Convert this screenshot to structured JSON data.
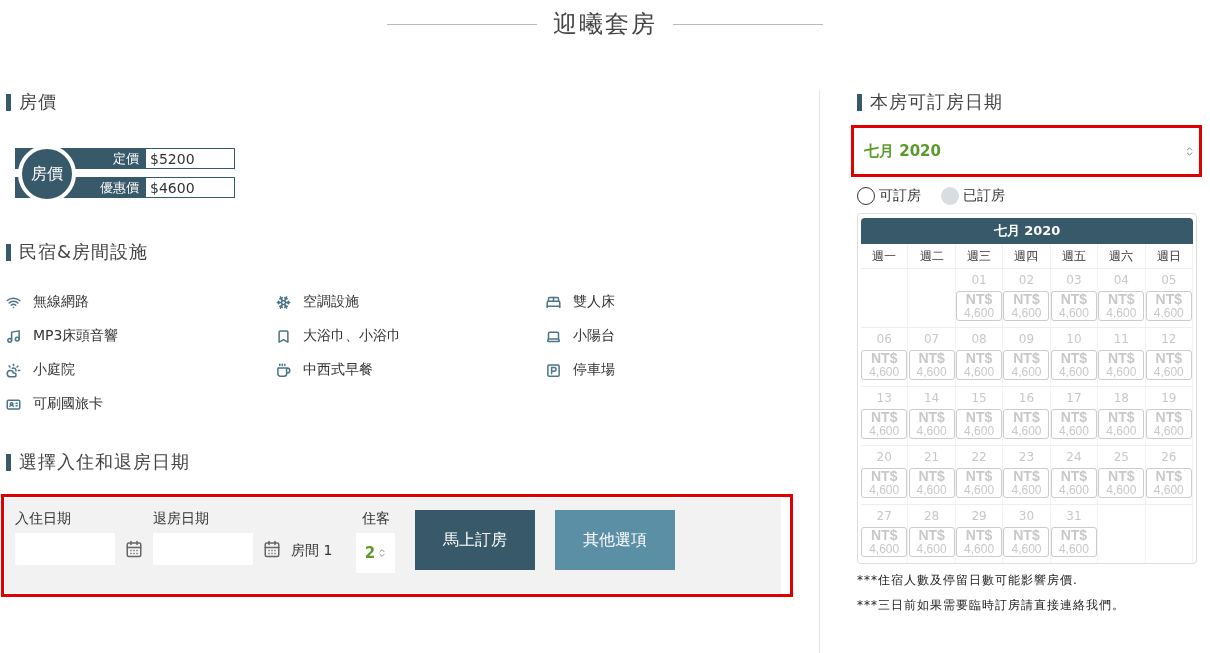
{
  "title": "迎曦套房",
  "price": {
    "heading": "房價",
    "badge": "房價",
    "rows": [
      {
        "label": "定價",
        "value": "$5200"
      },
      {
        "label": "優惠價",
        "value": "$4600"
      }
    ]
  },
  "facilities": {
    "heading": "民宿&房間設施",
    "items": [
      {
        "label": "無線網路"
      },
      {
        "label": "空調設施"
      },
      {
        "label": "雙人床"
      },
      {
        "label": "MP3床頭音響"
      },
      {
        "label": "大浴巾、小浴巾"
      },
      {
        "label": "小陽台"
      },
      {
        "label": "小庭院"
      },
      {
        "label": "中西式早餐"
      },
      {
        "label": "停車場"
      },
      {
        "label": "可刷國旅卡"
      }
    ]
  },
  "booking": {
    "heading": "選擇入住和退房日期",
    "highlighted": true,
    "checkin_label": "入住日期",
    "checkout_label": "退房日期",
    "room_label": "房間 1",
    "guests_label": "住客",
    "guests_value": "2",
    "buttons": [
      {
        "label": "馬上訂房",
        "kind": "primary"
      },
      {
        "label": "其他選項",
        "kind": "secondary"
      }
    ]
  },
  "availability": {
    "heading": "本房可訂房日期",
    "month_select": {
      "value": "七月 2020",
      "highlighted": true
    },
    "legend": [
      {
        "label": "可訂房",
        "kind": "available"
      },
      {
        "label": "已訂房",
        "kind": "booked"
      }
    ],
    "calendar": {
      "title": "七月 2020",
      "weekdays": [
        "週一",
        "週二",
        "週三",
        "週四",
        "週五",
        "週六",
        "週日"
      ],
      "days": [
        {
          "kind": "blank"
        },
        {
          "kind": "blank"
        },
        {
          "kind": "day",
          "day": "01",
          "currency": "NT$",
          "price": "4,600",
          "disabled": true
        },
        {
          "kind": "day",
          "day": "02",
          "currency": "NT$",
          "price": "4,600",
          "disabled": true
        },
        {
          "kind": "day",
          "day": "03",
          "currency": "NT$",
          "price": "4,600",
          "disabled": true
        },
        {
          "kind": "day",
          "day": "04",
          "currency": "NT$",
          "price": "4,600",
          "disabled": true
        },
        {
          "kind": "day",
          "day": "05",
          "currency": "NT$",
          "price": "4,600",
          "disabled": true
        },
        {
          "kind": "day",
          "day": "06",
          "currency": "NT$",
          "price": "4,600",
          "disabled": true
        },
        {
          "kind": "day",
          "day": "07",
          "currency": "NT$",
          "price": "4,600",
          "disabled": true
        },
        {
          "kind": "day",
          "day": "08",
          "currency": "NT$",
          "price": "4,600",
          "disabled": true
        },
        {
          "kind": "day",
          "day": "09",
          "currency": "NT$",
          "price": "4,600",
          "disabled": true
        },
        {
          "kind": "day",
          "day": "10",
          "currency": "NT$",
          "price": "4,600",
          "disabled": true
        },
        {
          "kind": "day",
          "day": "11",
          "currency": "NT$",
          "price": "4,600",
          "disabled": true
        },
        {
          "kind": "day",
          "day": "12",
          "currency": "NT$",
          "price": "4,600",
          "disabled": true
        },
        {
          "kind": "day",
          "day": "13",
          "currency": "NT$",
          "price": "4,600",
          "disabled": true
        },
        {
          "kind": "day",
          "day": "14",
          "currency": "NT$",
          "price": "4,600",
          "disabled": true
        },
        {
          "kind": "day",
          "day": "15",
          "currency": "NT$",
          "price": "4,600",
          "disabled": true
        },
        {
          "kind": "day",
          "day": "16",
          "currency": "NT$",
          "price": "4,600",
          "disabled": true
        },
        {
          "kind": "day",
          "day": "17",
          "currency": "NT$",
          "price": "4,600",
          "disabled": true
        },
        {
          "kind": "day",
          "day": "18",
          "currency": "NT$",
          "price": "4,600",
          "disabled": true
        },
        {
          "kind": "day",
          "day": "19",
          "currency": "NT$",
          "price": "4,600",
          "disabled": true
        },
        {
          "kind": "day",
          "day": "20",
          "currency": "NT$",
          "price": "4,600",
          "disabled": true
        },
        {
          "kind": "day",
          "day": "21",
          "currency": "NT$",
          "price": "4,600",
          "disabled": true
        },
        {
          "kind": "day",
          "day": "22",
          "currency": "NT$",
          "price": "4,600",
          "disabled": true
        },
        {
          "kind": "day",
          "day": "23",
          "currency": "NT$",
          "price": "4,600",
          "disabled": true
        },
        {
          "kind": "day",
          "day": "24",
          "currency": "NT$",
          "price": "4,600",
          "disabled": true
        },
        {
          "kind": "day",
          "day": "25",
          "currency": "NT$",
          "price": "4,600",
          "disabled": true
        },
        {
          "kind": "day",
          "day": "26",
          "currency": "NT$",
          "price": "4,600",
          "disabled": true
        },
        {
          "kind": "day",
          "day": "27",
          "currency": "NT$",
          "price": "4,600",
          "disabled": true
        },
        {
          "kind": "day",
          "day": "28",
          "currency": "NT$",
          "price": "4,600",
          "disabled": true
        },
        {
          "kind": "day",
          "day": "29",
          "currency": "NT$",
          "price": "4,600",
          "disabled": true
        },
        {
          "kind": "day",
          "day": "30",
          "currency": "NT$",
          "price": "4,600",
          "disabled": true
        },
        {
          "kind": "day",
          "day": "31",
          "currency": "NT$",
          "price": "4,600",
          "disabled": true
        },
        {
          "kind": "blank"
        },
        {
          "kind": "blank"
        }
      ]
    },
    "notes": [
      "***住宿人數及停留日數可能影響房價.",
      "***三日前如果需要臨時訂房請直接連絡我們。"
    ]
  }
}
